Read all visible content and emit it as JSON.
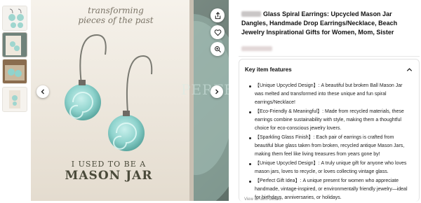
{
  "product": {
    "title": "Glass Spiral Earrings: Upcycled Mason Jar Dangles, Handmade Drop Earrings/Necklace, Beach Jewelry Inspirational Gifts for Women, Mom, Sister"
  },
  "image": {
    "card_top_text_1": "transforming",
    "card_top_text_2": "pieces of the past",
    "card_bottom_line_1": "I USED TO BE A",
    "card_bottom_line_2": "MASON JAR",
    "jar_text": "PERFE"
  },
  "features": {
    "header": "Key item features",
    "items": [
      "【Unique Upcycled Design】: A beautiful but broken Ball Mason Jar was melted and transformed into these unique and fun spiral earrings/Necklace!",
      "【Eco-Friendly & Meaningful】: Made from recycled materials, these earrings combine sustainability with style, making them a thoughtful choice for eco-conscious jewelry lovers.",
      "【Sparkling Glass Finish】: Each pair of earrings is crafted from beautiful blue glass taken from broken, recycled antique Mason Jars, making them feel like living treasures from years gone by!",
      "【Unique Upcycled Design】: A truly unique gift for anyone who loves mason jars, loves to recycle, or loves collecting vintage glass.",
      "【Perfect Gift Idea】: A unique present for women who appreciate handmade, vintage-inspired, or environmentally friendly jewelry—ideal for birthdays, anniversaries, or holidays."
    ],
    "more_label": "View all item details"
  },
  "icons": {
    "share": "share-icon",
    "favorite": "heart-icon",
    "zoom": "zoom-icon",
    "prev": "chevron-left-icon",
    "next": "chevron-right-icon",
    "collapse": "chevron-up-icon"
  },
  "colors": {
    "glass": "#8fd3cd",
    "card": "#f3eee6",
    "card_text": "#4a4a3a"
  }
}
